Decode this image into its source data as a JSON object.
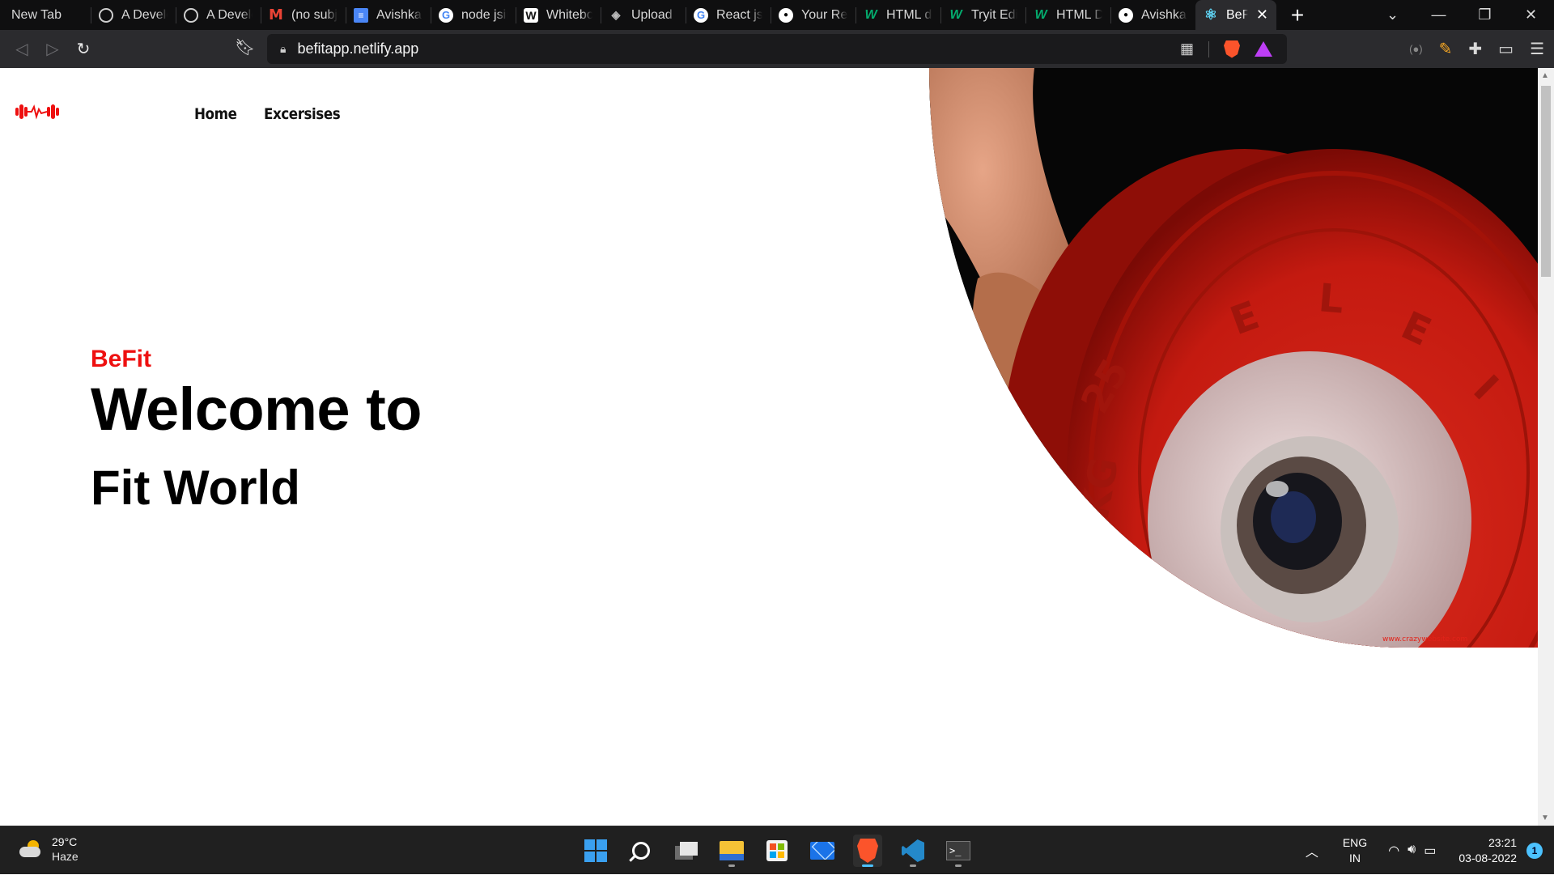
{
  "browser": {
    "tabs": [
      {
        "title": "New Tab",
        "favicon": "none-icon"
      },
      {
        "title": "A Develo",
        "favicon": "globe-icon"
      },
      {
        "title": "A Develo",
        "favicon": "globe-icon"
      },
      {
        "title": "(no subje",
        "favicon": "gmail-icon"
      },
      {
        "title": "Avishkar",
        "favicon": "docs-icon"
      },
      {
        "title": "node jsin",
        "favicon": "google-icon"
      },
      {
        "title": "Whitebo",
        "favicon": "whiteboard-icon"
      },
      {
        "title": "Upload I",
        "favicon": "upload-icon"
      },
      {
        "title": "React js",
        "favicon": "google-icon"
      },
      {
        "title": "Your Rep",
        "favicon": "github-icon"
      },
      {
        "title": "HTML da",
        "favicon": "w3schools-icon"
      },
      {
        "title": "Tryit Edit",
        "favicon": "w3schools-icon"
      },
      {
        "title": "HTML D",
        "favicon": "w3schools-icon"
      },
      {
        "title": "Avishkar",
        "favicon": "github-icon"
      }
    ],
    "active_tab": {
      "title": "BeFit",
      "favicon": "react-icon"
    },
    "url": "befitapp.netlify.app"
  },
  "page": {
    "nav": {
      "home": "Home",
      "exercises": "Excersises"
    },
    "hero": {
      "brand": "BeFit",
      "line1": "Welcome to",
      "line2": "Fit World"
    },
    "hero_image_watermark": "www.crazywebsite.com",
    "accent_color": "#ee1010"
  },
  "taskbar": {
    "weather": {
      "temp": "29°C",
      "condition": "Haze"
    },
    "apps": [
      "start-icon",
      "search-icon",
      "task-view-icon",
      "file-explorer-icon",
      "store-icon",
      "mail-icon",
      "brave-browser-icon",
      "vscode-icon",
      "terminal-icon"
    ],
    "lang": {
      "line1": "ENG",
      "line2": "IN"
    },
    "time": "23:21",
    "date": "03-08-2022",
    "notifications": "1"
  }
}
